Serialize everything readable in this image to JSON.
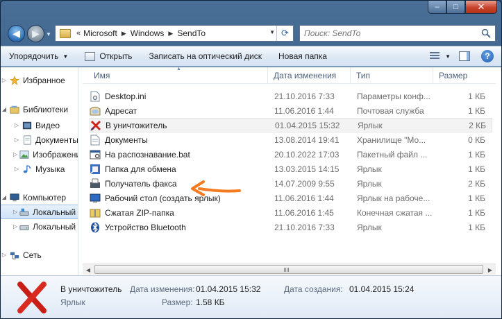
{
  "window": {
    "buttons": {
      "minimize": "–",
      "maximize": "□",
      "close": "✕"
    }
  },
  "nav": {
    "back_label": "◀",
    "forward_label": "▶",
    "address": {
      "chevron": "«",
      "parts": [
        "Microsoft",
        "Windows",
        "SendTo"
      ]
    },
    "search_placeholder": "Поиск: SendTo"
  },
  "toolbar": {
    "organize": "Упорядочить",
    "open": "Открыть",
    "burn": "Записать на оптический диск",
    "new_folder": "Новая папка",
    "help": "?"
  },
  "sidebar": {
    "items": [
      {
        "label": "Избранное",
        "icon": "star-icon"
      },
      {
        "label": "Библиотеки",
        "icon": "library-icon"
      },
      {
        "label": "Видео",
        "icon": "video-icon"
      },
      {
        "label": "Документы",
        "icon": "documents-icon"
      },
      {
        "label": "Изображения",
        "icon": "pictures-icon"
      },
      {
        "label": "Музыка",
        "icon": "music-icon"
      },
      {
        "label": "Компьютер",
        "icon": "computer-icon"
      },
      {
        "label": "Локальный диск (C:)",
        "icon": "drive-icon"
      },
      {
        "label": "Локальный диск (D:)",
        "icon": "drive-icon"
      },
      {
        "label": "Сеть",
        "icon": "network-icon"
      }
    ]
  },
  "columns": {
    "name": "Имя",
    "date": "Дата изменения",
    "type": "Тип",
    "size": "Размер"
  },
  "files": [
    {
      "name": "Desktop.ini",
      "date": "21.10.2016 7:33",
      "type": "Параметры конф...",
      "size": "1 КБ",
      "icon": "settings-file-icon"
    },
    {
      "name": "Адресат",
      "date": "11.06.2016 1:44",
      "type": "Почтовая служба",
      "size": "1 КБ",
      "icon": "mail-recipient-icon"
    },
    {
      "name": "В уничтожитель",
      "date": "01.04.2015 15:32",
      "type": "Ярлык",
      "size": "2 КБ",
      "icon": "shredder-x-icon"
    },
    {
      "name": "Документы",
      "date": "13.08.2014 19:41",
      "type": "Хранилище \"Мо...",
      "size": "0 КБ",
      "icon": "documents-icon"
    },
    {
      "name": "На распознавание.bat",
      "date": "20.10.2022 17:03",
      "type": "Пакетный файл ...",
      "size": "1 КБ",
      "icon": "batch-file-icon"
    },
    {
      "name": "Папка для обмена",
      "date": "13.03.2015 14:15",
      "type": "Ярлык",
      "size": "1 КБ",
      "icon": "share-folder-icon"
    },
    {
      "name": "Получатель факса",
      "date": "14.07.2009 9:55",
      "type": "Ярлык",
      "size": "2 КБ",
      "icon": "fax-icon"
    },
    {
      "name": "Рабочий стол (создать ярлык)",
      "date": "11.06.2016 1:44",
      "type": "Ярлык на рабоче...",
      "size": "1 КБ",
      "icon": "desktop-icon"
    },
    {
      "name": "Сжатая ZIP-папка",
      "date": "11.06.2016 1:45",
      "type": "Конечная сжатая ...",
      "size": "1 КБ",
      "icon": "zip-folder-icon"
    },
    {
      "name": "Устройство Bluetooth",
      "date": "21.10.2016 7:33",
      "type": "Ярлык",
      "size": "1 КБ",
      "icon": "bluetooth-icon"
    }
  ],
  "details": {
    "name": "В уничтожитель",
    "type": "Ярлык",
    "modified_label": "Дата изменения:",
    "modified_value": "01.04.2015 15:32",
    "size_label": "Размер:",
    "size_value": "1.58 КБ",
    "created_label": "Дата создания:",
    "created_value": "01.04.2015 15:24"
  },
  "colors": {
    "annotation_arrow": "#f47b20",
    "selection": "#cfe3f8"
  }
}
